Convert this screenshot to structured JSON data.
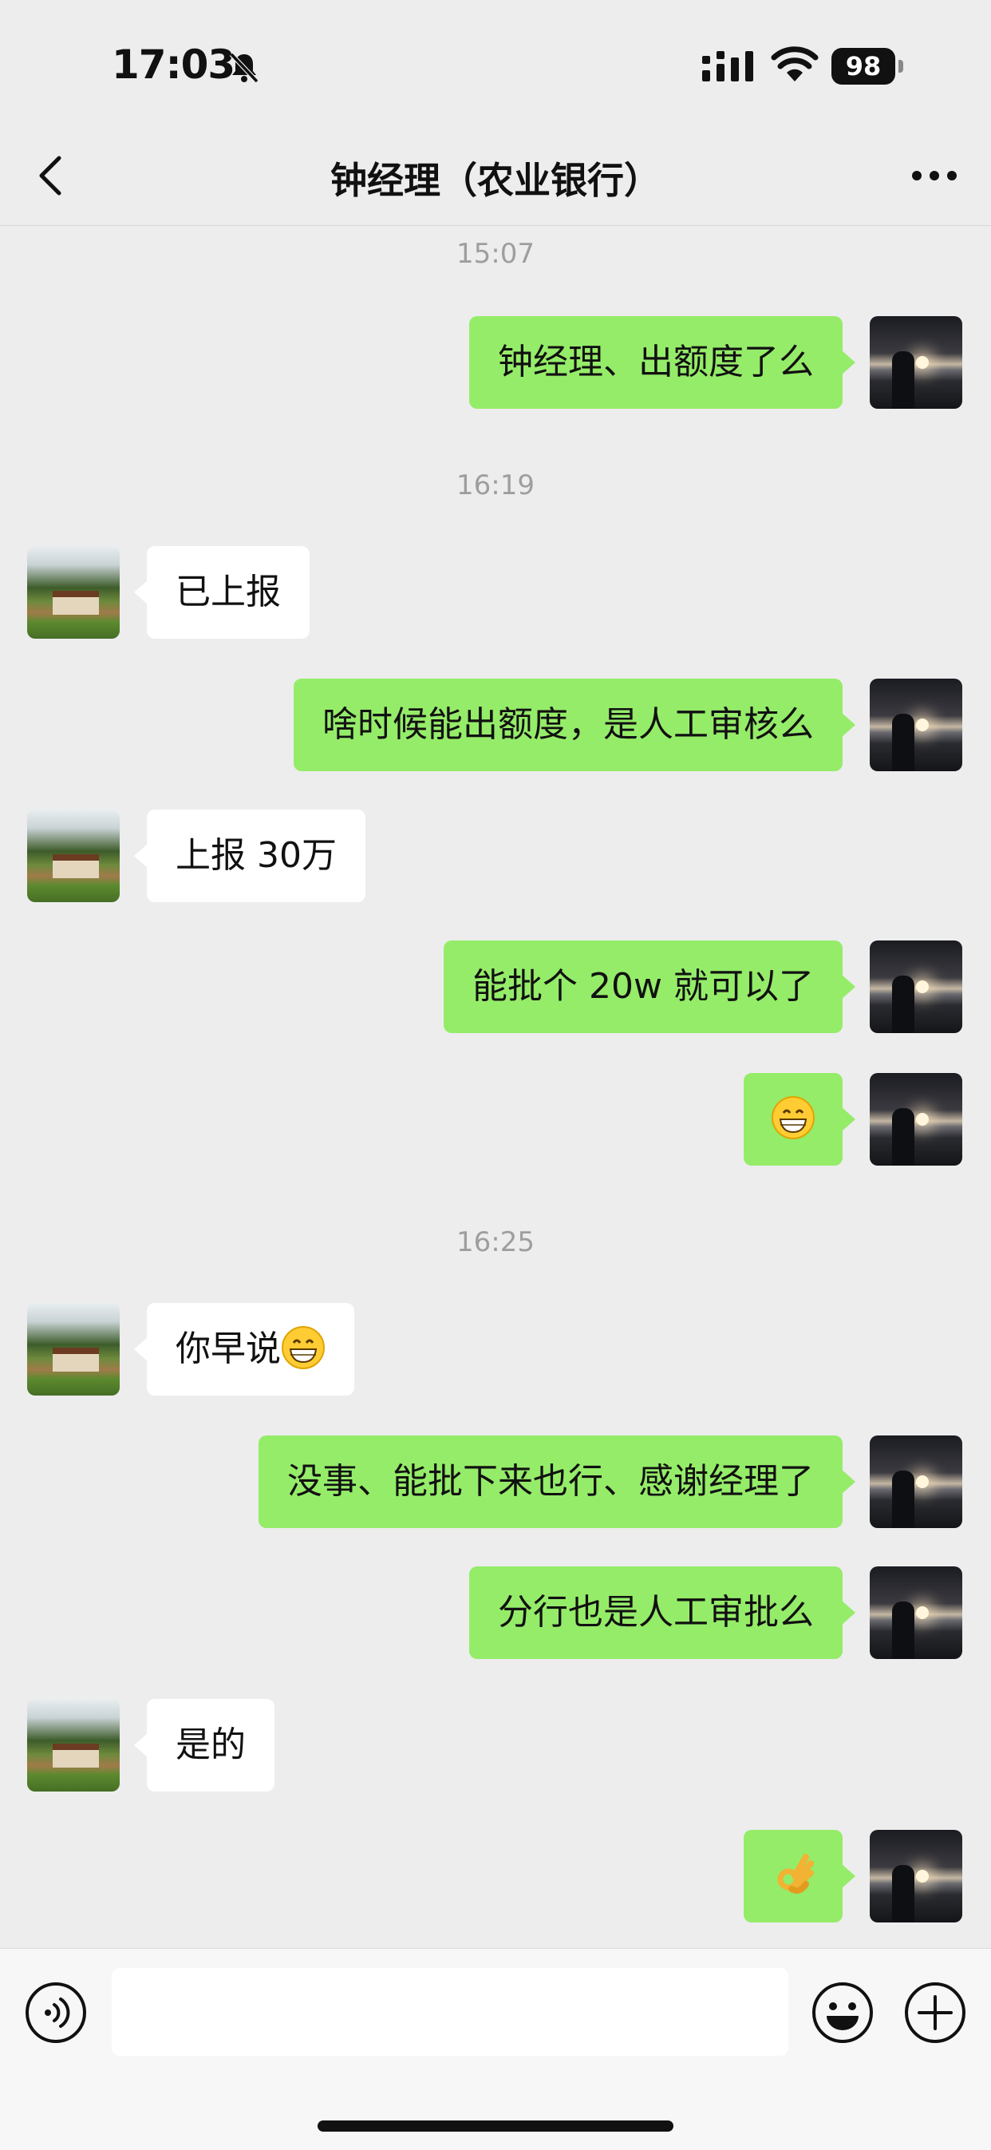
{
  "status": {
    "time": "17:03",
    "battery": "98"
  },
  "nav": {
    "title": "钟经理（农业银行）"
  },
  "chat": {
    "timestamps": [
      "15:07",
      "16:19",
      "16:25"
    ],
    "messages": [
      {
        "from": "me",
        "text": "钟经理、出额度了么"
      },
      {
        "from": "them",
        "text": "已上报"
      },
      {
        "from": "me",
        "text": "啥时候能出额度，是人工审核么"
      },
      {
        "from": "them",
        "text": "上报 30万"
      },
      {
        "from": "me",
        "text": "能批个 20w 就可以了"
      },
      {
        "from": "me",
        "text": "",
        "emoji": "grin-emoji"
      },
      {
        "from": "them",
        "text": "你早说",
        "emoji": "grin-emoji"
      },
      {
        "from": "me",
        "text": "没事、能批下来也行、感谢经理了"
      },
      {
        "from": "me",
        "text": "分行也是人工审批么"
      },
      {
        "from": "them",
        "text": "是的"
      },
      {
        "from": "me",
        "text": "",
        "emoji": "ok-hand-emoji"
      }
    ]
  },
  "input": {
    "value": "",
    "placeholder": ""
  },
  "colors": {
    "me_bubble": "#95ec69",
    "them_bubble": "#ffffff",
    "background": "#ededed"
  }
}
